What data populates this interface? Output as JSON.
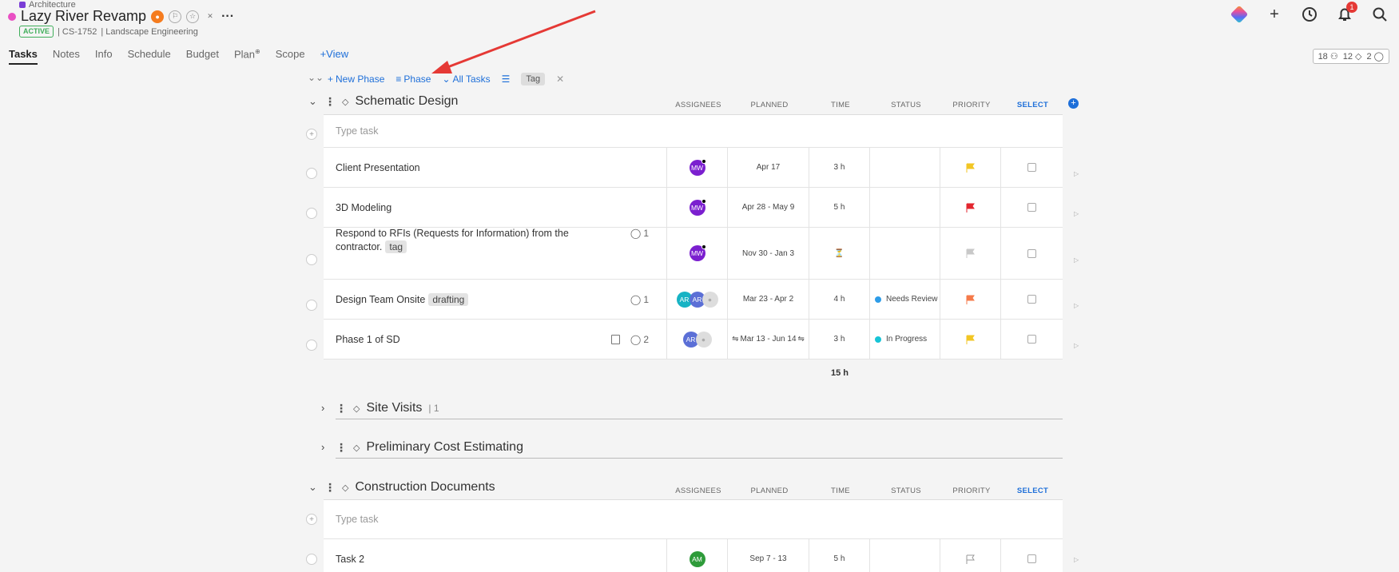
{
  "header": {
    "breadcrumb": "Architecture",
    "title": "Lazy River Revamp",
    "status_badge": "ACTIVE",
    "code": "| CS-1752",
    "client": "| Landscape Engineering",
    "notification_count": "1"
  },
  "tabs": [
    {
      "label": "Tasks"
    },
    {
      "label": "Notes"
    },
    {
      "label": "Info"
    },
    {
      "label": "Schedule"
    },
    {
      "label": "Budget"
    },
    {
      "label": "Plan"
    },
    {
      "label": "Scope"
    },
    {
      "label": "+View"
    }
  ],
  "counts": {
    "people": "18",
    "diamonds": "12",
    "comments": "2"
  },
  "toolbar": {
    "new_phase": "New Phase",
    "phase": "Phase",
    "all_tasks": "All Tasks",
    "tag": "Tag"
  },
  "columns": {
    "assignees": "ASSIGNEES",
    "planned": "PLANNED",
    "time": "TIME",
    "status": "STATUS",
    "priority": "PRIORITY",
    "select": "SELECT"
  },
  "type_task_placeholder": "Type task",
  "phases": [
    {
      "name": "Schematic Design",
      "total_time": "15 h",
      "tasks": [
        {
          "name": "Client Presentation",
          "assignees": [
            "MW"
          ],
          "planned": "Apr 17",
          "time": "3 h",
          "status": "",
          "priority_color": "#f2c624"
        },
        {
          "name": "3D Modeling",
          "assignees": [
            "MW"
          ],
          "planned": "Apr 28 - May 9",
          "time": "5 h",
          "status": "",
          "priority_color": "#e3262f"
        },
        {
          "name_line1": "Respond to RFIs (Requests for Information) from the",
          "name_line2": "contractor.",
          "tag": "tag",
          "comments": "1",
          "assignees": [
            "MW"
          ],
          "planned": "Nov 30 - Jan 3",
          "time": "⏳",
          "status": "",
          "priority_color": "#c8c8c8"
        },
        {
          "name": "Design Team Onsite",
          "tag": "drafting",
          "comments": "1",
          "assignees": [
            "AR",
            "AR"
          ],
          "planned": "Mar 23 - Apr 2",
          "time": "4 h",
          "status": "Needs Review",
          "status_color": "#2d9ce8",
          "priority_color": "#f57a4a"
        },
        {
          "name": "Phase 1 of SD",
          "comments": "2",
          "assignees": [
            "AR"
          ],
          "planned": "Mar 13 - Jun 14",
          "time": "3 h",
          "status": "In Progress",
          "status_color": "#17c4d6",
          "priority_color": "#f2c624"
        }
      ]
    },
    {
      "name": "Site Visits",
      "count": "1"
    },
    {
      "name": "Preliminary Cost Estimating"
    },
    {
      "name": "Construction Documents",
      "tasks": [
        {
          "name": "Task 2",
          "assignees": [
            "AM"
          ],
          "planned": "Sep 7 - 13",
          "time": "5 h",
          "status": "",
          "priority_color": "none"
        }
      ]
    }
  ]
}
